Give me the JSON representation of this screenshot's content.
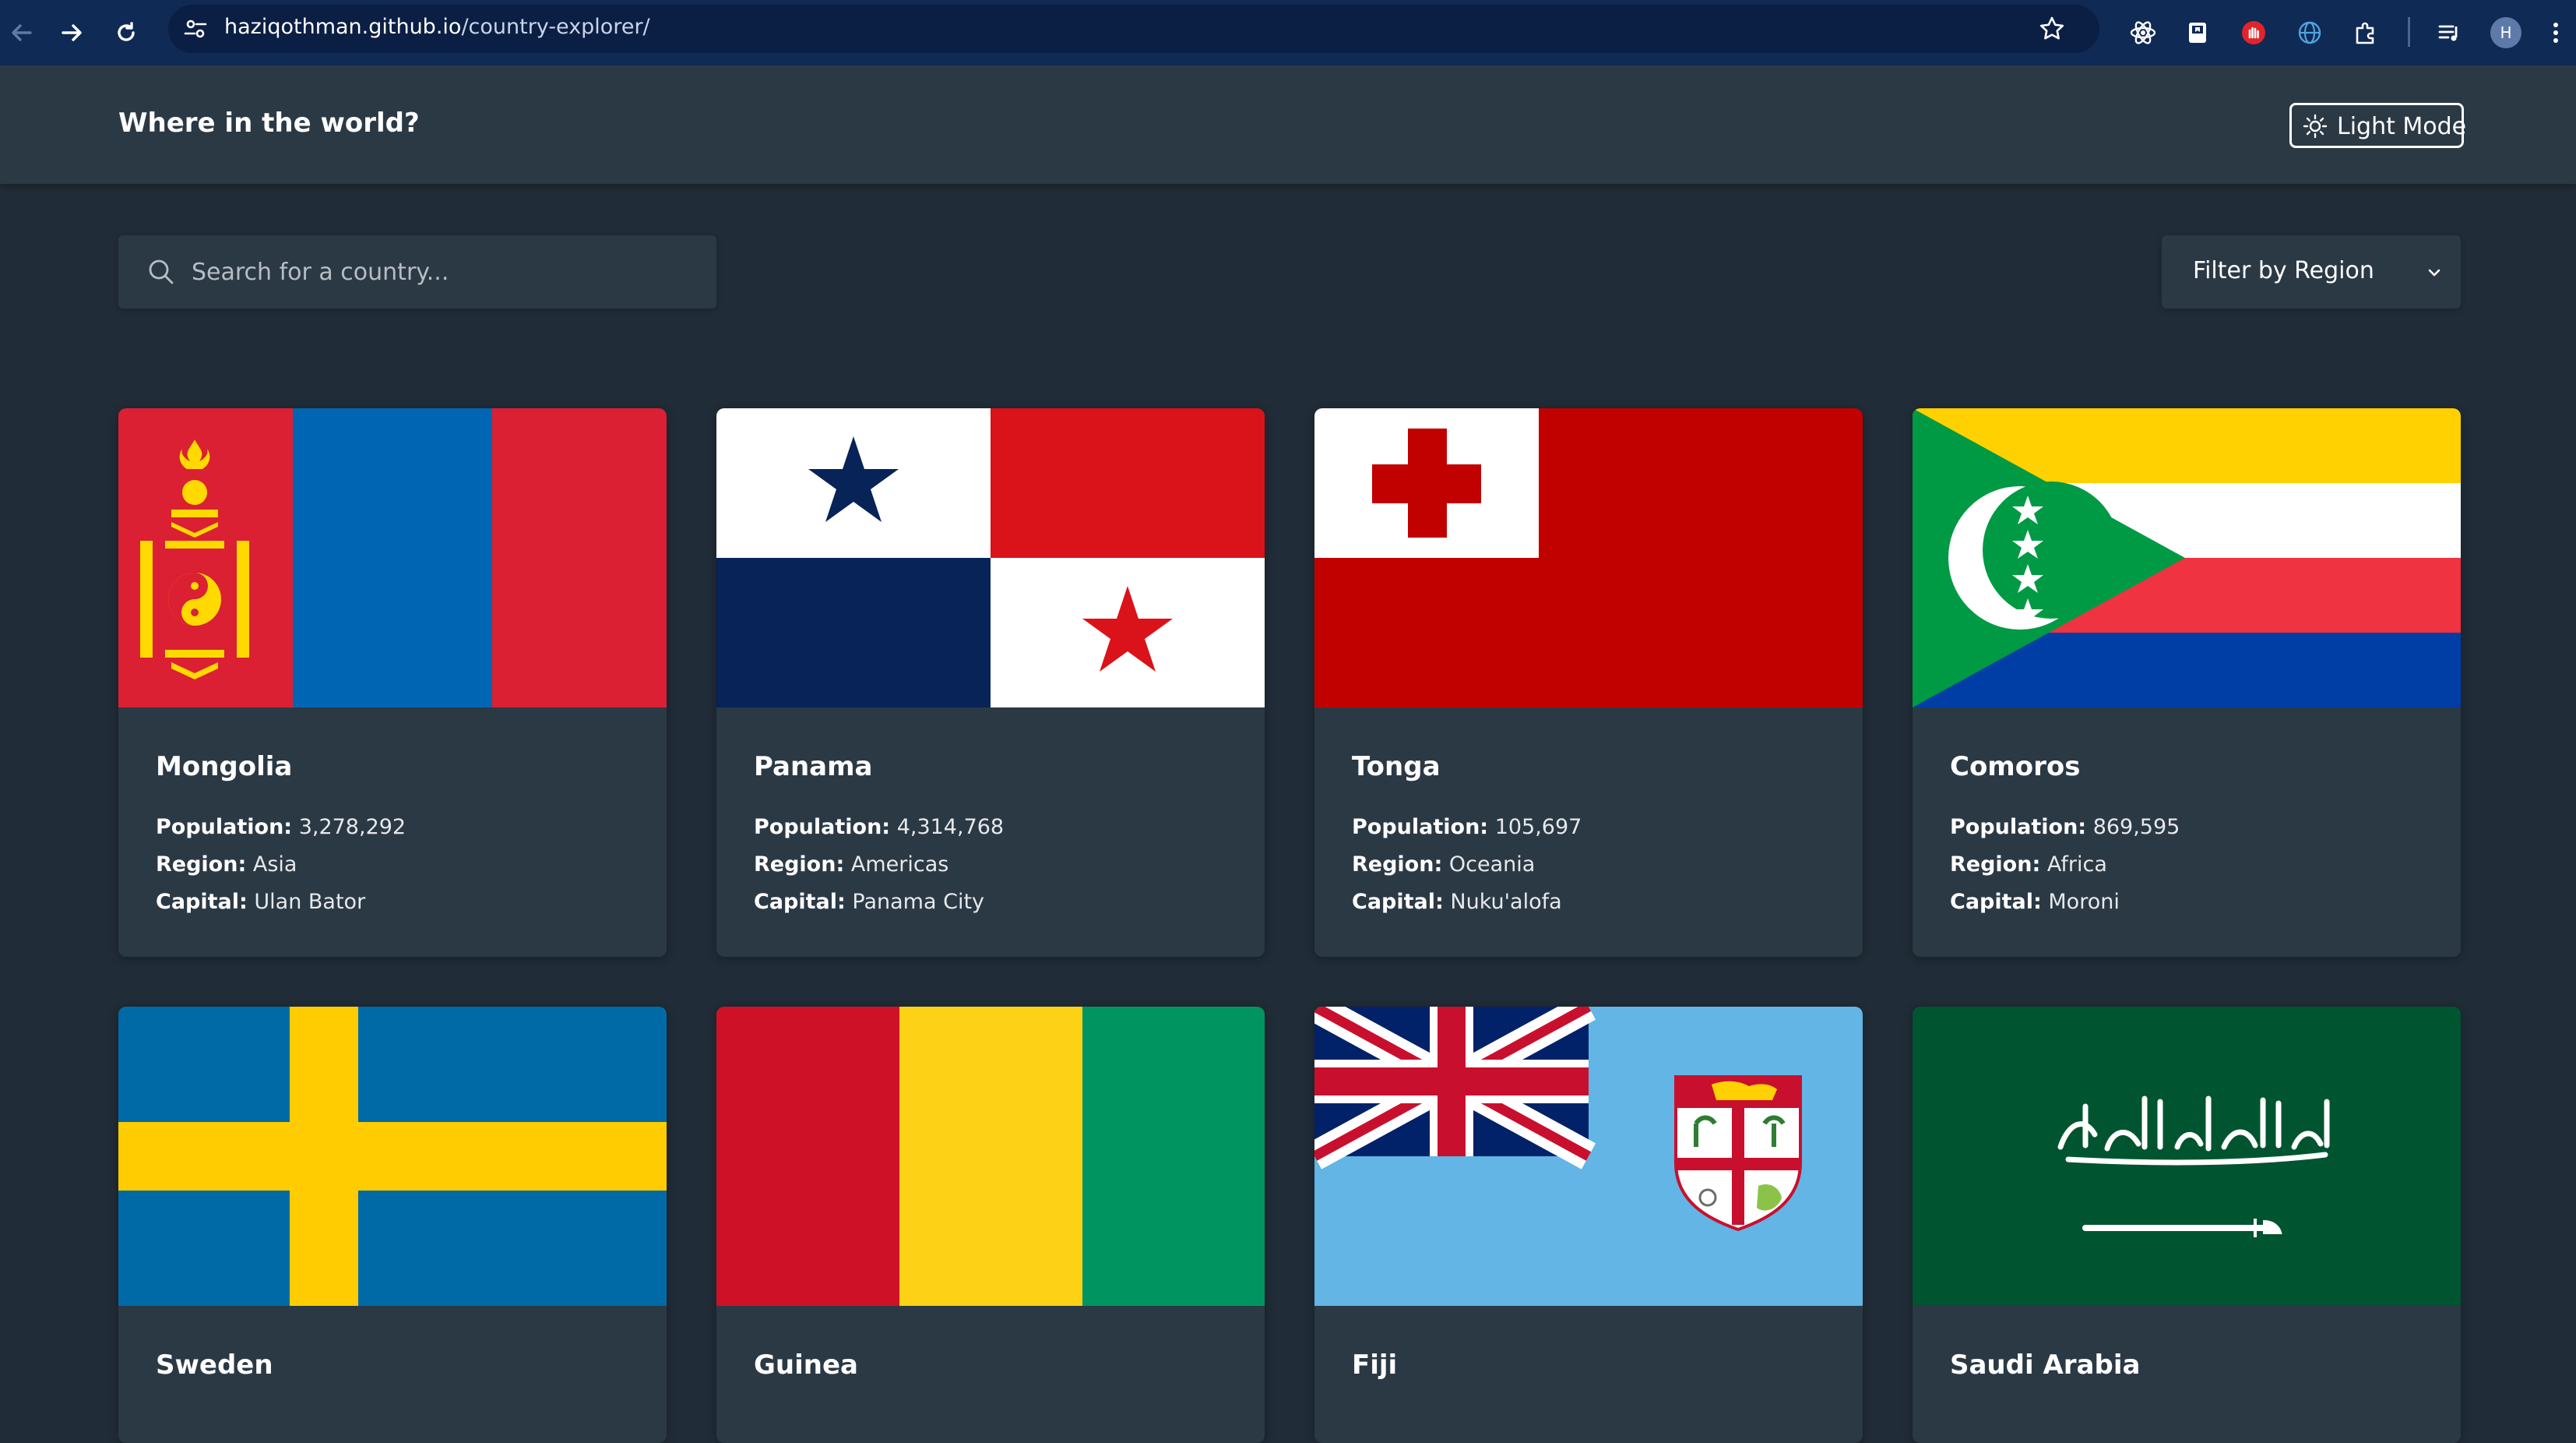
{
  "browser": {
    "url_domain": "haziqothman.github.io",
    "url_path": "/country-explorer/",
    "profile_initial": "H"
  },
  "header": {
    "title": "Where in the world?",
    "mode_label": "Light Mode"
  },
  "search": {
    "placeholder": "Search for a country..."
  },
  "filter": {
    "label": "Filter by Region"
  },
  "labels": {
    "population": "Population:",
    "region": "Region:",
    "capital": "Capital:"
  },
  "countries": [
    {
      "name": "Mongolia",
      "population": "3,278,292",
      "region": "Asia",
      "capital": "Ulan Bator"
    },
    {
      "name": "Panama",
      "population": "4,314,768",
      "region": "Americas",
      "capital": "Panama City"
    },
    {
      "name": "Tonga",
      "population": "105,697",
      "region": "Oceania",
      "capital": "Nuku'alofa"
    },
    {
      "name": "Comoros",
      "population": "869,595",
      "region": "Africa",
      "capital": "Moroni"
    },
    {
      "name": "Sweden"
    },
    {
      "name": "Guinea"
    },
    {
      "name": "Fiji"
    },
    {
      "name": "Saudi Arabia"
    }
  ],
  "colors": {
    "background": "#202c37",
    "elements": "#2b3945",
    "browser_bar": "#0f2a55"
  }
}
